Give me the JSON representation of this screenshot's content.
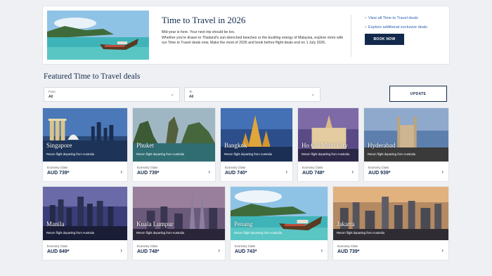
{
  "hero": {
    "title": "Time to Travel in 2026",
    "body_lines": [
      "Mid-year is here. Your next trip should be too.",
      "Whether you're drawn to Thailand's sun-drenched beaches or the bustling energy of Malaysia, explore more with our Time to Travel deals now. Make the most of 2026 and book before flight deals end on 1 July 2026."
    ],
    "links": [
      "View all Time to Travel deals",
      "Explore additional exclusive deals"
    ],
    "cta": "BOOK NOW"
  },
  "section_title": "Featured Time to Travel deals",
  "filters": {
    "from": {
      "label": "From",
      "value": "All"
    },
    "to": {
      "label": "To",
      "value": "All"
    },
    "update": "UPDATE"
  },
  "deals": [
    {
      "city": "Singapore",
      "subtitle": "Return flight departing from Australia",
      "class": "Economy Class",
      "price": "AUD 739*"
    },
    {
      "city": "Phuket",
      "subtitle": "Return flight departing from Australia",
      "class": "Economy Class",
      "price": "AUD 739*"
    },
    {
      "city": "Bangkok",
      "subtitle": "Return flight departing from Australia",
      "class": "Economy Class",
      "price": "AUD 740*"
    },
    {
      "city": "Ho Chi Minh City",
      "subtitle": "Return flight departing from Australia",
      "class": "Economy Class",
      "price": "AUD 748*"
    },
    {
      "city": "Hyderabad",
      "subtitle": "Return flight departing from Australia",
      "class": "Economy Class",
      "price": "AUD 939*"
    },
    {
      "city": "Manila",
      "subtitle": "Return flight departing from Australia",
      "class": "Economy Class",
      "price": "AUD 849*"
    },
    {
      "city": "Kuala Lumpur",
      "subtitle": "Return flight departing from Australia",
      "class": "Economy Class",
      "price": "AUD 748*"
    },
    {
      "city": "Penang",
      "subtitle": "Return flight departing from Australia",
      "class": "Economy Class",
      "price": "AUD 743*"
    },
    {
      "city": "Jakarta",
      "subtitle": "Return flight departing from Australia",
      "class": "Economy Class",
      "price": "AUD 739*"
    }
  ],
  "icons": {
    "link": "chevron-right-icon",
    "card_arrow": "chevron-right-icon",
    "select": "chevron-down-icon"
  },
  "colors": {
    "brand_navy": "#13294b",
    "link_blue": "#2a5fb0"
  }
}
